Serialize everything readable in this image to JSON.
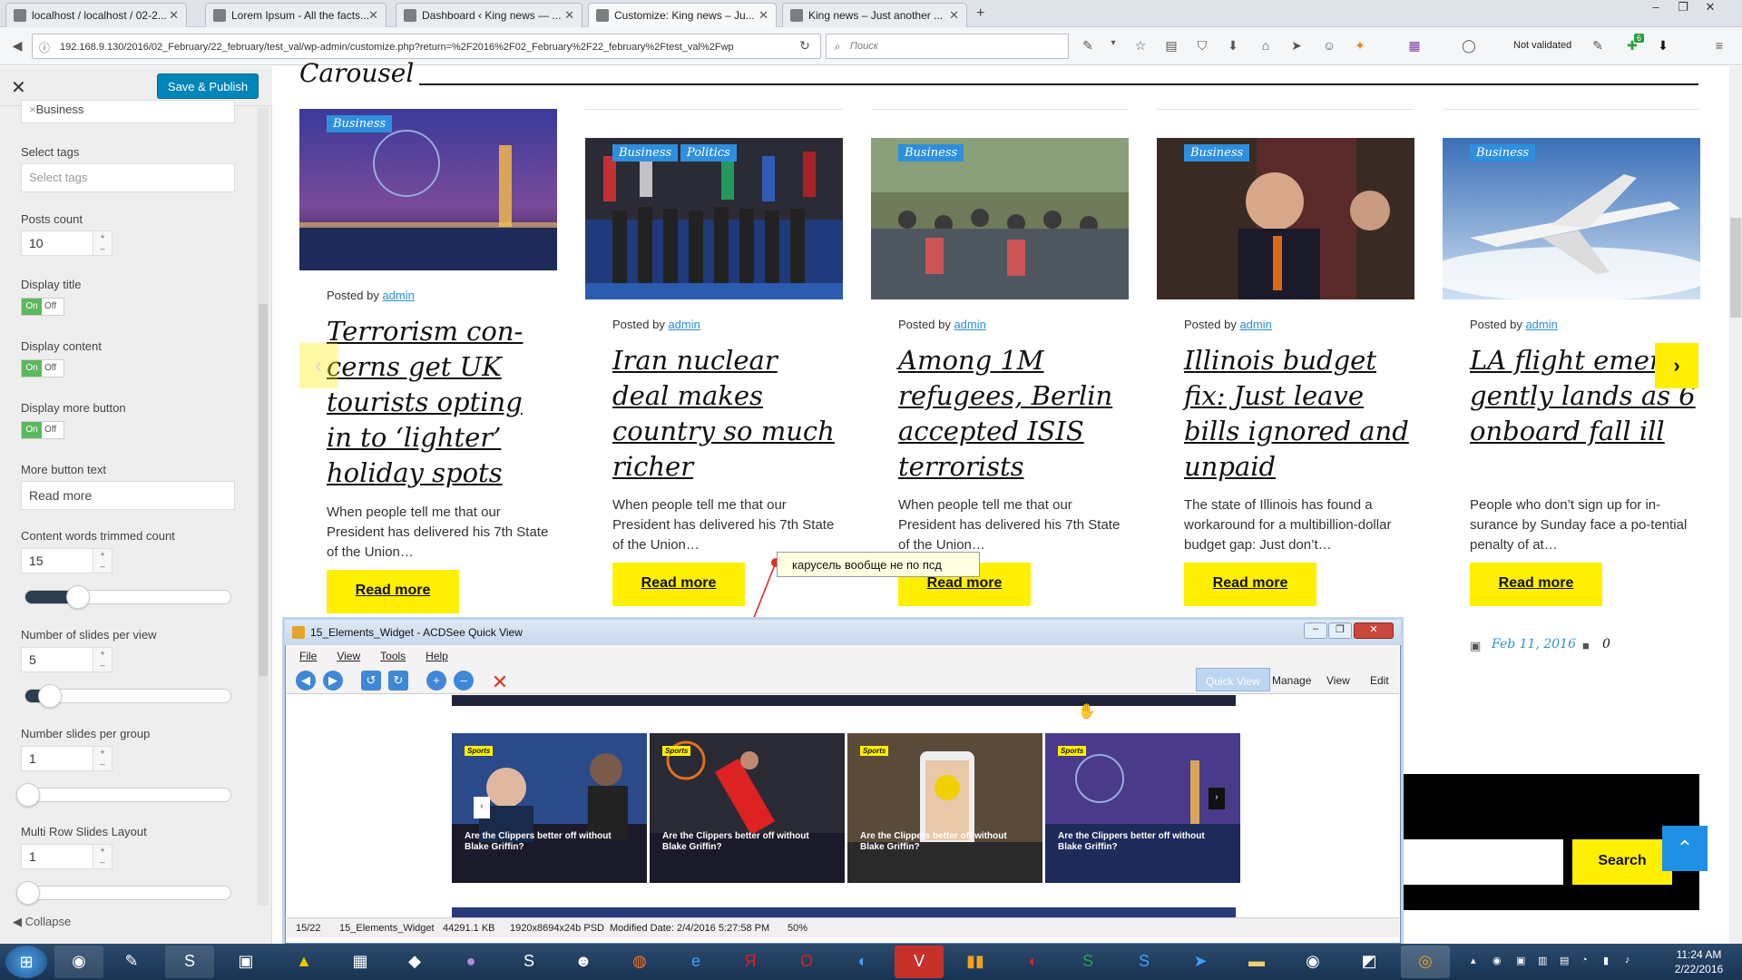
{
  "browser": {
    "tabs": [
      {
        "label": "localhost / localhost / 02-2..."
      },
      {
        "label": "Lorem Ipsum - All the facts..."
      },
      {
        "label": "Dashboard ‹ King news — ..."
      },
      {
        "label": "Customize: King news – Ju..."
      },
      {
        "label": "King news – Just another ..."
      }
    ],
    "new_tab": "+",
    "url": "192.168.9.130/2016/02_February/22_february/test_val/wp-admin/customize.php?return=%2F2016%2F02_February%2F22_february%2Ftest_val%2Fwp",
    "search_placeholder": "Поиск",
    "not_validated": "Not validated",
    "badge_count": "6"
  },
  "customizer": {
    "close_label": "✕",
    "save_label": "Save & Publish",
    "selected_category": "Business",
    "select_tags_label": "Select tags",
    "select_tags_placeholder": "Select tags",
    "posts_count_label": "Posts count",
    "posts_count_value": "10",
    "display_title_label": "Display title",
    "display_content_label": "Display content",
    "display_more_label": "Display more button",
    "toggle_on": "On",
    "toggle_off": "Off",
    "more_text_label": "More button text",
    "more_text_value": "Read more",
    "trim_label": "Content words trimmed count",
    "trim_value": "15",
    "slides_view_label": "Number of slides per view",
    "slides_view_value": "5",
    "slides_group_label": "Number slides per group",
    "slides_group_value": "1",
    "multirow_label": "Multi Row Slides Layout",
    "multirow_value": "1",
    "collapse_label": "Collapse"
  },
  "preview": {
    "section_title": "Carousel",
    "posted_by": "Posted by",
    "author": "admin",
    "read_more": "Read more",
    "cards": [
      {
        "categories": [
          "Business"
        ],
        "title": "Terrorism con-cerns get UK tourists opting in to ‘lighter’ holiday spots",
        "excerpt": "When people tell me that our President has delivered his 7th State of the Union…"
      },
      {
        "categories": [
          "Business",
          "Politics"
        ],
        "title": "Iran nuclear deal makes country so much richer",
        "excerpt": "When people tell me that our President has delivered his 7th State of the Union…"
      },
      {
        "categories": [
          "Business"
        ],
        "title": "Among 1M refugees, Berlin accepted ISIS terrorists",
        "excerpt": "When people tell me that our President has delivered his 7th State of the Union…"
      },
      {
        "categories": [
          "Business"
        ],
        "title": "Illinois budget fix: Just leave bills ignored and unpaid",
        "excerpt": "The state of Illinois has found a workaround for a multibillion-dollar budget gap: Just don’t…"
      },
      {
        "categories": [
          "Business"
        ],
        "title": "LA flight emer-gently lands as 6 onboard fall ill",
        "excerpt": "People who don’t sign up for in-surance by Sunday face a po-tential penalty of at…"
      }
    ],
    "date": "Feb 11, 2016",
    "comments": "0",
    "search_button": "Search",
    "note": "карусель вообще не по псд"
  },
  "acdsee": {
    "title": "15_Elements_Widget - ACDSee Quick View",
    "menu": [
      "File",
      "View",
      "Tools",
      "Help"
    ],
    "modes": [
      "Quick View",
      "Manage",
      "View",
      "Edit"
    ],
    "thumbs": [
      {
        "tag": "Sports",
        "title": "Are the Clippers better off without Blake Griffin?"
      },
      {
        "tag": "Sports",
        "title": "Are the Clippers better off without Blake Griffin?"
      },
      {
        "tag": "Sports",
        "title": "Are the Clippers better off without Blake Griffin?"
      },
      {
        "tag": "Sports",
        "title": "Are the Clippers better off without Blake Griffin?"
      }
    ],
    "status": {
      "index": "15/22",
      "name": "15_Elements_Widget",
      "size": "44291.1 KB",
      "dims": "1920x8694x24b PSD",
      "modified": "Modified Date: 2/4/2016 5:27:58 PM",
      "zoom": "50%"
    }
  },
  "taskbar": {
    "time": "11:24 AM",
    "date": "2/22/2016"
  },
  "colors": {
    "accent_yellow": "#ffef00",
    "wp_blue": "#0085ba",
    "category_blue": "#2e8fde",
    "link_blue": "#2a8fd6"
  }
}
